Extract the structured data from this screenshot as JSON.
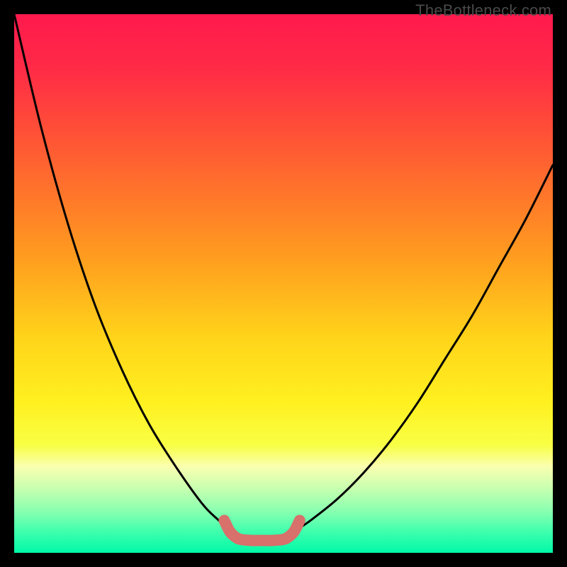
{
  "watermark": "TheBottleneck.com",
  "colors": {
    "frame": "#000000",
    "gradient_stops": [
      {
        "offset": 0.0,
        "color": "#ff1a4d"
      },
      {
        "offset": 0.1,
        "color": "#ff2a46"
      },
      {
        "offset": 0.25,
        "color": "#ff5a33"
      },
      {
        "offset": 0.45,
        "color": "#ff9c1f"
      },
      {
        "offset": 0.6,
        "color": "#ffd41a"
      },
      {
        "offset": 0.72,
        "color": "#fff020"
      },
      {
        "offset": 0.8,
        "color": "#f8ff44"
      },
      {
        "offset": 0.84,
        "color": "#faffb0"
      },
      {
        "offset": 0.88,
        "color": "#c8ffb0"
      },
      {
        "offset": 0.92,
        "color": "#8dffb0"
      },
      {
        "offset": 0.96,
        "color": "#40ffad"
      },
      {
        "offset": 1.0,
        "color": "#00f9a8"
      }
    ],
    "curve_black": "#000000",
    "curve_red_dull": "#d8706b"
  },
  "chart_data": {
    "type": "line",
    "title": "",
    "xlabel": "",
    "ylabel": "",
    "xlim": [
      0,
      100
    ],
    "ylim": [
      0,
      100
    ],
    "series": [
      {
        "name": "left_curve_black",
        "x": [
          0,
          5,
          10,
          15,
          20,
          25,
          30,
          35,
          38,
          40
        ],
        "values": [
          100,
          79,
          61,
          46,
          34,
          24,
          16,
          9,
          6,
          4
        ]
      },
      {
        "name": "right_curve_black",
        "x": [
          52,
          55,
          60,
          65,
          70,
          75,
          80,
          85,
          90,
          95,
          100
        ],
        "values": [
          4,
          6,
          10,
          15,
          21,
          28,
          36,
          44,
          53,
          62,
          72
        ]
      },
      {
        "name": "bottom_red_segment",
        "x": [
          39,
          40,
          41,
          42,
          44,
          46,
          48,
          50,
          51,
          52,
          53
        ],
        "values": [
          6,
          4,
          3,
          2.5,
          2.3,
          2.3,
          2.3,
          2.5,
          3,
          4,
          6
        ]
      }
    ],
    "annotations": []
  }
}
